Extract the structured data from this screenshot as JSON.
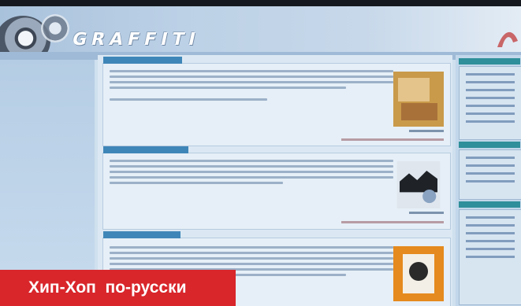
{
  "site": {
    "logo_text": "GRAFFITI"
  },
  "caption": {
    "text": "Хип-Хоп  по-русски"
  },
  "colors": {
    "caption_bg": "#d8262b",
    "header_bg": "#bcd1e6",
    "section_title_bg": "#3f86b8",
    "sidebar_head_bg": "#2f8f9a"
  }
}
